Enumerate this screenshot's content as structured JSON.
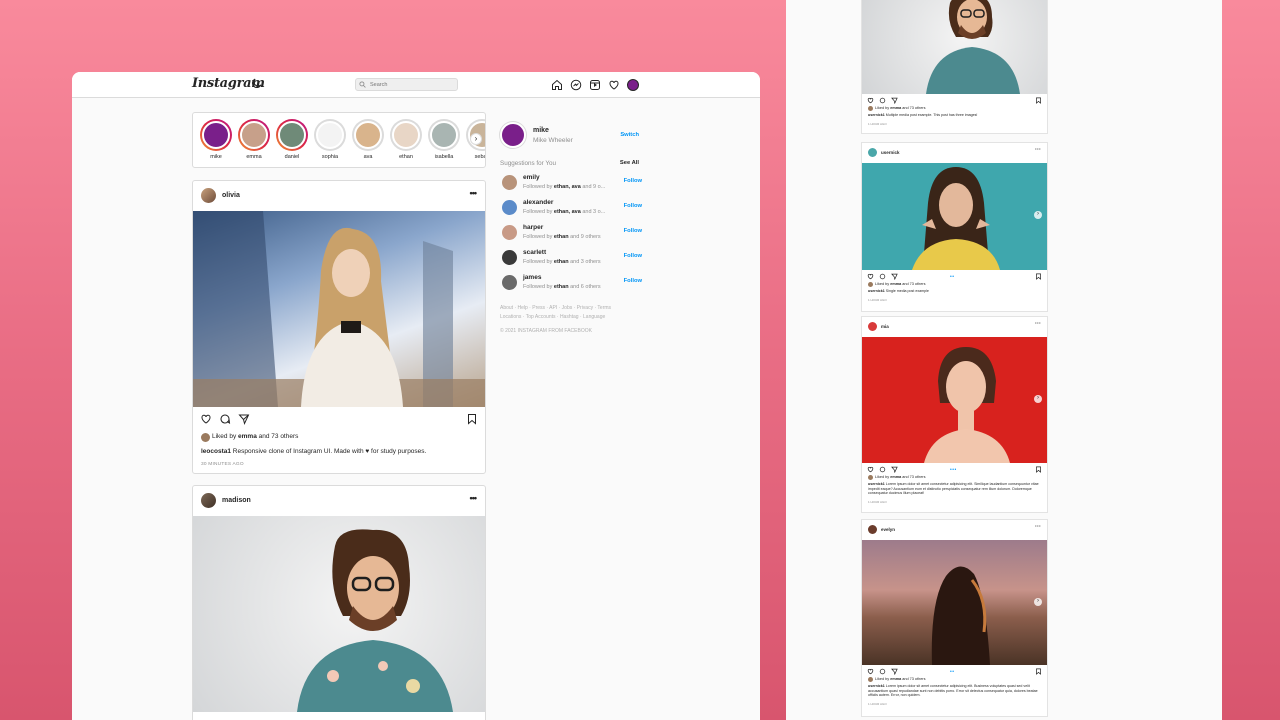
{
  "colors": {
    "background_top": "#f98a9c",
    "background_bottom": "#d8556e",
    "link": "#0095f6",
    "story_ring_new": "#dc2743"
  },
  "nav": {
    "logo": "Instagram",
    "search_placeholder": "Search",
    "icons": [
      "home-icon",
      "messenger-icon",
      "explore-icon",
      "heart-icon",
      "avatar"
    ]
  },
  "stories": [
    {
      "name": "mike",
      "state": "new"
    },
    {
      "name": "emma",
      "state": "new"
    },
    {
      "name": "daniel",
      "state": "new"
    },
    {
      "name": "sophia",
      "state": "seen"
    },
    {
      "name": "ava",
      "state": "seen"
    },
    {
      "name": "ethan",
      "state": "seen"
    },
    {
      "name": "isabella",
      "state": "seen"
    },
    {
      "name": "sebas",
      "state": "seen"
    }
  ],
  "posts": [
    {
      "user": "olivia",
      "likes_prefix": "Liked by ",
      "likes_user": "emma",
      "likes_suffix": " and 73 others",
      "caption_user": "leocosta1",
      "caption_text": " Responsive clone of Instagram UI. Made with ♥ for study purposes.",
      "time": "30 MINUTES AGO"
    },
    {
      "user": "madison"
    }
  ],
  "sidebar": {
    "me_username": "mike",
    "me_fullname": "Mike Wheeler",
    "switch": "Switch",
    "suggestions_title": "Suggestions for You",
    "see_all": "See All",
    "suggestions": [
      {
        "name": "emily",
        "followed_prefix": "Followed by ",
        "followed_bold": "ethan, ava",
        "followed_suffix": " and 9 o...",
        "follow": "Follow"
      },
      {
        "name": "alexander",
        "followed_prefix": "Followed by ",
        "followed_bold": "ethan, ava",
        "followed_suffix": " and 3 o...",
        "follow": "Follow"
      },
      {
        "name": "harper",
        "followed_prefix": "Followed by ",
        "followed_bold": "ethan",
        "followed_suffix": " and 9 others",
        "follow": "Follow"
      },
      {
        "name": "scarlett",
        "followed_prefix": "Followed by ",
        "followed_bold": "ethan",
        "followed_suffix": " and 3 others",
        "follow": "Follow"
      },
      {
        "name": "james",
        "followed_prefix": "Followed by ",
        "followed_bold": "ethan",
        "followed_suffix": " and 6 others",
        "follow": "Follow"
      }
    ],
    "footer_line1": "About · Help · Press · API · Jobs · Privacy · Terms",
    "footer_line2": "Locations · Top Accounts · Hashtag · Language",
    "copyright": "© 2021 INSTAGRAM FROM FACEBOOK"
  },
  "mobile": {
    "top_post": {
      "likes_prefix": "Liked by ",
      "likes_user": "emma",
      "likes_suffix": " and 73 others",
      "caption_user": "usernick1",
      "caption_text": " Multiple media post example. This post has three images!",
      "time": "1 HOUR AGO"
    },
    "posts": [
      {
        "user": "usernick",
        "likes_prefix": "Liked by ",
        "likes_user": "emma",
        "likes_suffix": " and 73 others",
        "caption_user": "usernick1",
        "caption_text": " Single media post example",
        "time": "1 HOUR AGO"
      },
      {
        "user": "mia",
        "likes_prefix": "Liked by ",
        "likes_user": "emma",
        "likes_suffix": " and 73 others",
        "caption_user": "usernick1",
        "caption_text": " Lorem ipsum dolor sit amet consectetur adipisicing elit. Similique laudantium consequuntur vitae impedit eaque? Accusantium eum et distinctio perspiciatis consequatur rem illum dolorum. Doloremque consequatur ducimus illum placeat!",
        "time": "1 HOUR AGO"
      },
      {
        "user": "evelyn",
        "likes_prefix": "Liked by ",
        "likes_user": "emma",
        "likes_suffix": " and 73 others",
        "caption_user": "usernick1",
        "caption_text": " Lorem ipsum dolor sit amet consectetur adipisicing elit. Business voluptates quasi sed velit accusantium quasi repudiandae sunt non debitis porro. Error sit delectus consequatur quia, dolores beatae officiis autem. Error, non quidem.",
        "time": "1 HOUR AGO"
      }
    ]
  }
}
